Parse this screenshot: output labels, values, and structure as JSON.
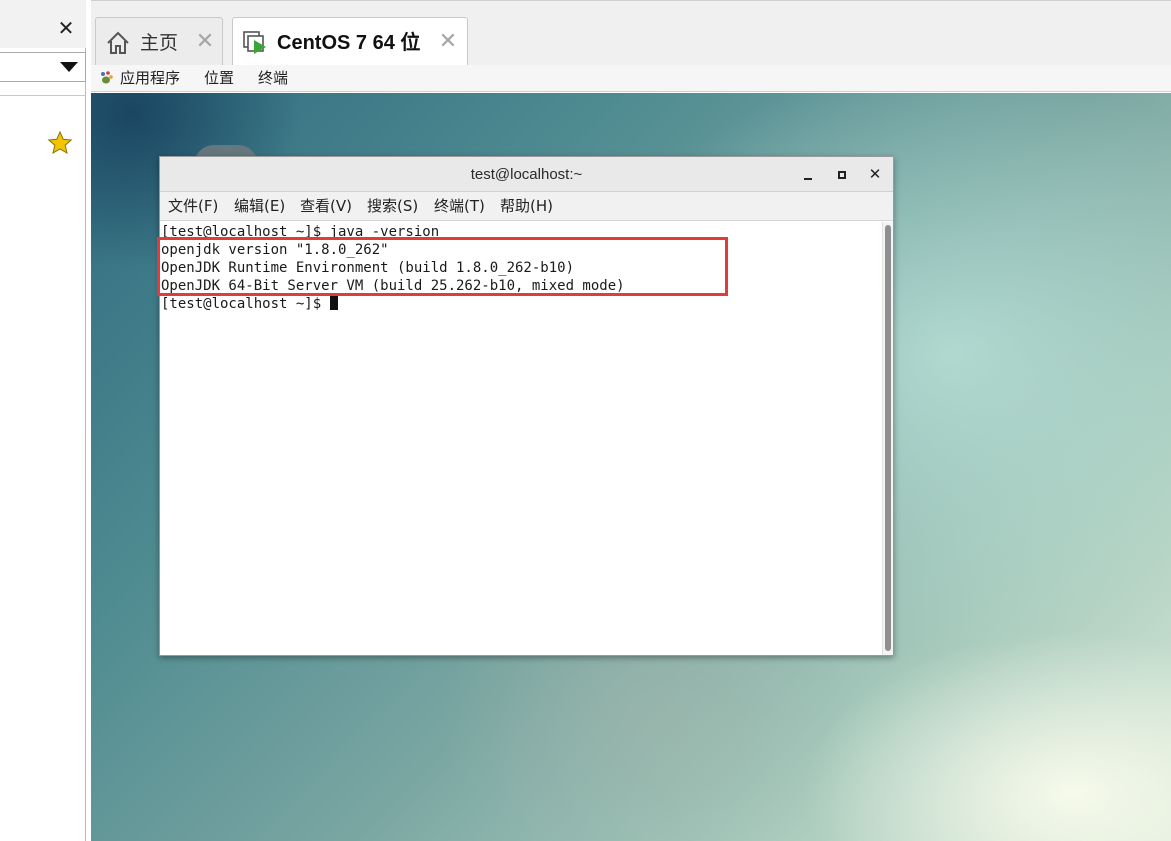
{
  "library": {
    "close_symbol": "✕"
  },
  "tabs": [
    {
      "label": "主页",
      "close_symbol": "✕"
    },
    {
      "label": "CentOS 7 64 位",
      "close_symbol": "✕"
    }
  ],
  "gnome_bar": {
    "applications": "应用程序",
    "places": "位置",
    "terminal": "终端"
  },
  "terminal": {
    "title": "test@localhost:~",
    "close_symbol": "✕",
    "menu": {
      "file": "文件(F)",
      "edit": "编辑(E)",
      "view": "查看(V)",
      "search": "搜索(S)",
      "terminal": "终端(T)",
      "help": "帮助(H)"
    },
    "lines": [
      "[test@localhost ~]$ java -version",
      "openjdk version \"1.8.0_262\"",
      "OpenJDK Runtime Environment (build 1.8.0_262-b10)",
      "OpenJDK 64-Bit Server VM (build 25.262-b10, mixed mode)",
      "[test@localhost ~]$ "
    ]
  },
  "colors": {
    "highlight_border": "#e23b3b",
    "star": "#f2c500",
    "play_green": "#3aa63a"
  }
}
